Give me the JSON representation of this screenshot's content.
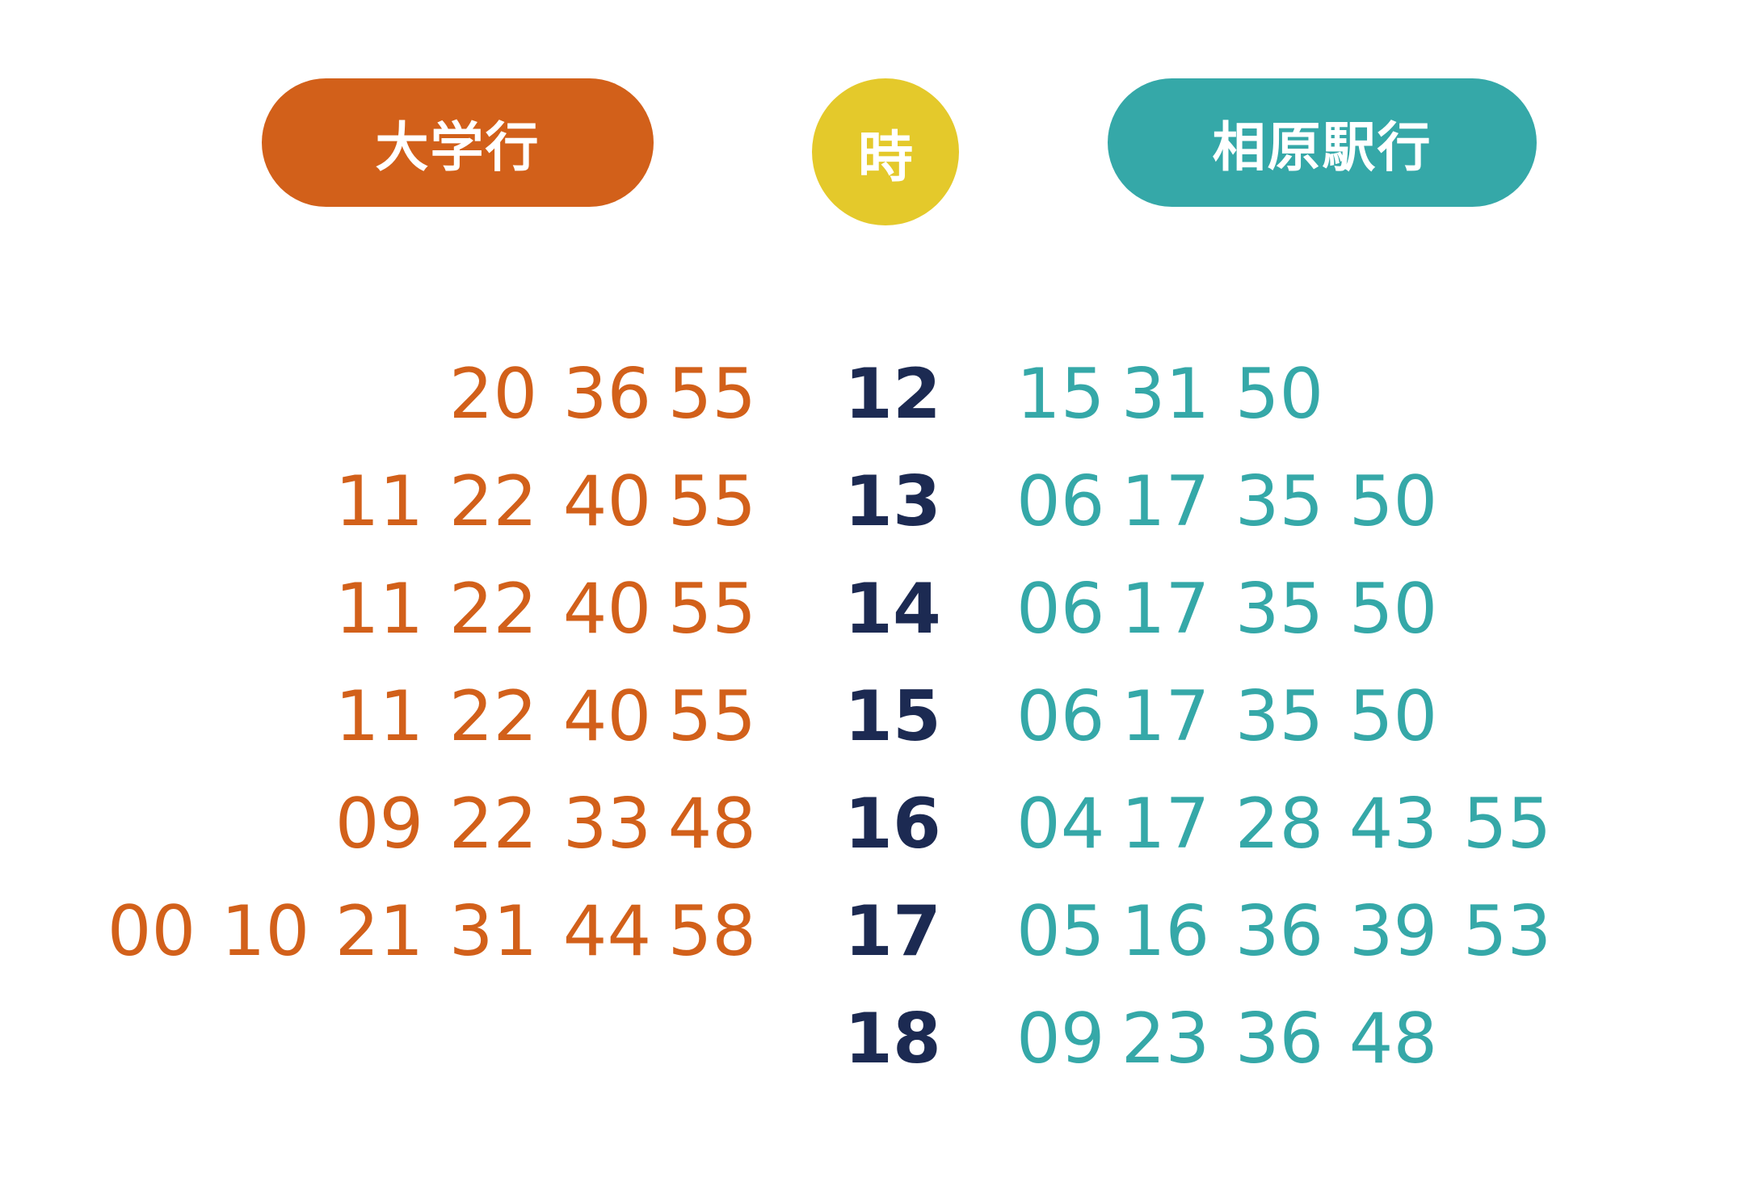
{
  "header": {
    "university_bound_label": "大学行",
    "hour_label": "時",
    "station_bound_label": "相原駅行"
  },
  "colors": {
    "university_bound": "#d2601a",
    "hour_badge": "#e4c92b",
    "hour_numbers": "#1c2a52",
    "station_bound": "#35a8a8"
  },
  "timetable": {
    "rows": [
      {
        "hour": "12",
        "university_bound": [
          "20",
          "36",
          "55"
        ],
        "station_bound": [
          "15",
          "31",
          "50"
        ]
      },
      {
        "hour": "13",
        "university_bound": [
          "11",
          "22",
          "40",
          "55"
        ],
        "station_bound": [
          "06",
          "17",
          "35",
          "50"
        ]
      },
      {
        "hour": "14",
        "university_bound": [
          "11",
          "22",
          "40",
          "55"
        ],
        "station_bound": [
          "06",
          "17",
          "35",
          "50"
        ]
      },
      {
        "hour": "15",
        "university_bound": [
          "11",
          "22",
          "40",
          "55"
        ],
        "station_bound": [
          "06",
          "17",
          "35",
          "50"
        ]
      },
      {
        "hour": "16",
        "university_bound": [
          "09",
          "22",
          "33",
          "48"
        ],
        "station_bound": [
          "04",
          "17",
          "28",
          "43",
          "55"
        ]
      },
      {
        "hour": "17",
        "university_bound": [
          "00",
          "10",
          "21",
          "31",
          "44",
          "58"
        ],
        "station_bound": [
          "05",
          "16",
          "36",
          "39",
          "53"
        ]
      },
      {
        "hour": "18",
        "university_bound": [],
        "station_bound": [
          "09",
          "23",
          "36",
          "48"
        ]
      }
    ]
  }
}
